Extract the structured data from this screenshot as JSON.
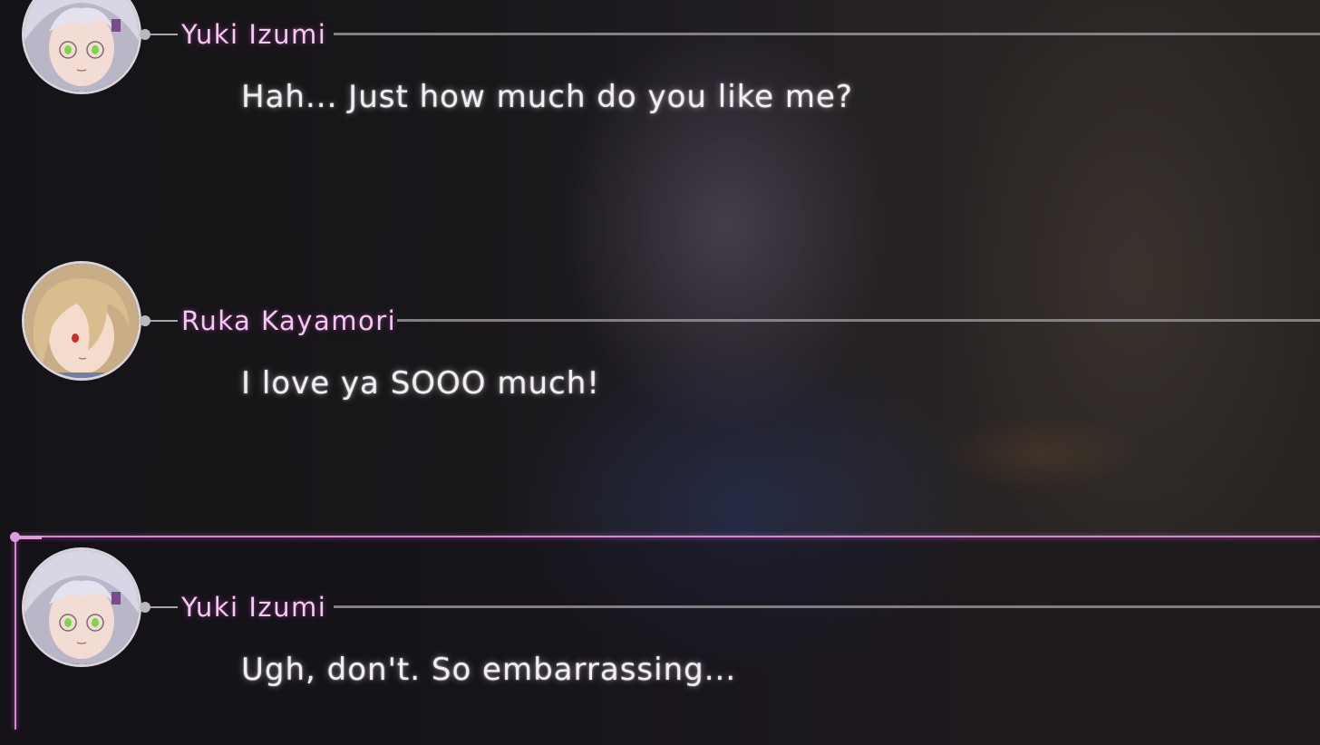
{
  "backlog": {
    "entries": [
      {
        "speaker": "Yuki Izumi",
        "text": "Hah... Just how much do you like me?",
        "avatar": "yuki-avatar",
        "selected": false
      },
      {
        "speaker": "Ruka Kayamori",
        "text": "I love ya SOOO much!",
        "avatar": "ruka-avatar",
        "selected": false
      },
      {
        "speaker": "Yuki Izumi",
        "text": "Ugh, don't. So embarrassing...",
        "avatar": "yuki-avatar",
        "selected": true
      }
    ]
  },
  "colors": {
    "name": "#f6c7f3",
    "text": "#f3eef4",
    "highlight": "#d886d6"
  }
}
